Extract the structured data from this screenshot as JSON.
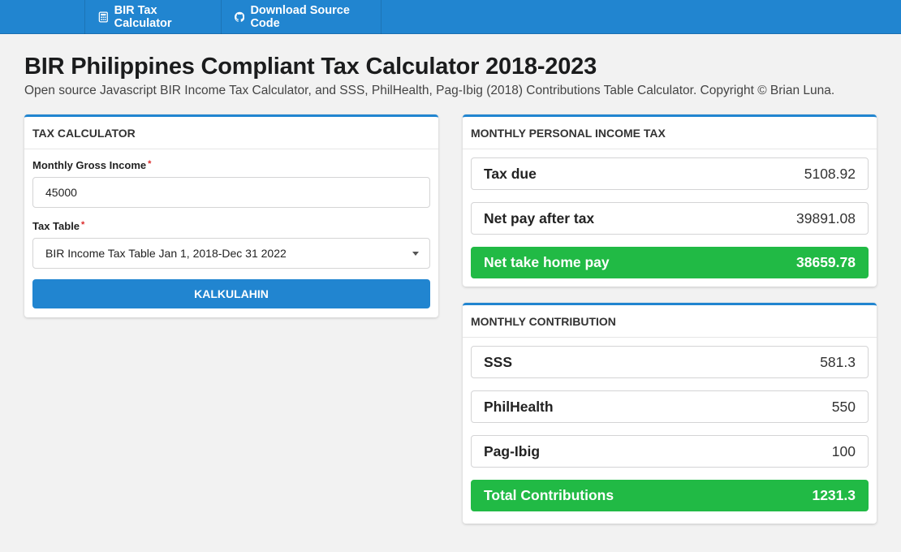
{
  "navbar": {
    "items": [
      {
        "label": "BIR Tax Calculator",
        "icon": "calculator-icon"
      },
      {
        "label": "Download Source Code",
        "icon": "github-icon"
      }
    ]
  },
  "header": {
    "title": "BIR Philippines Compliant Tax Calculator 2018-2023",
    "subtitle": "Open source Javascript BIR Income Tax Calculator, and SSS, PhilHealth, Pag-Ibig (2018) Contributions Table Calculator. Copyright © Brian Luna."
  },
  "calculator": {
    "heading": "TAX CALCULATOR",
    "gross_income_label": "Monthly Gross Income",
    "gross_income_value": "45000",
    "tax_table_label": "Tax Table",
    "tax_table_value": "BIR Income Tax Table Jan 1, 2018-Dec 31 2022",
    "required_marker": "*",
    "button_label": "KALKULAHIN"
  },
  "income_tax": {
    "heading": "MONTHLY PERSONAL INCOME TAX",
    "rows": [
      {
        "label": "Tax due",
        "value": "5108.92"
      },
      {
        "label": "Net pay after tax",
        "value": "39891.08"
      },
      {
        "label": "Net take home pay",
        "value": "38659.78"
      }
    ]
  },
  "contribution": {
    "heading": "MONTHLY CONTRIBUTION",
    "rows": [
      {
        "label": "SSS",
        "value": "581.3"
      },
      {
        "label": "PhilHealth",
        "value": "550"
      },
      {
        "label": "Pag-Ibig",
        "value": "100"
      },
      {
        "label": "Total Contributions",
        "value": "1231.3"
      }
    ]
  },
  "colors": {
    "primary": "#2185d0",
    "success": "#21ba45",
    "required": "#db2828",
    "background": "#f2f2f2"
  }
}
